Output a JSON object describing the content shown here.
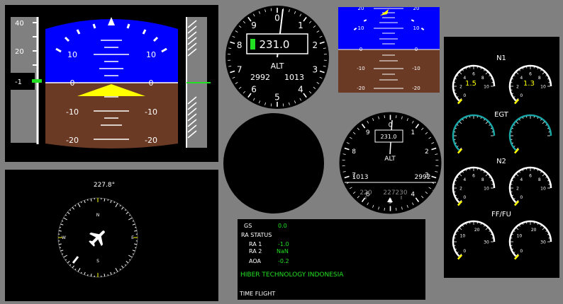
{
  "pfd": {
    "speed_ticks": [
      "40",
      "20",
      "-1"
    ],
    "pitch_labels": [
      "10",
      "0",
      "-10",
      "-20"
    ],
    "colors": {
      "sky": "#0000ff",
      "ground": "#6b3a24",
      "aircraft": "#ffff00",
      "marker": "#22e022"
    }
  },
  "mini_attitude": {
    "pitch_labels": [
      "20",
      "10",
      "0",
      "-10",
      "-20"
    ]
  },
  "altimeter_large": {
    "value": "231.0",
    "label": "ALT",
    "baro_left": "2992",
    "baro_right": "1013",
    "dial": [
      "0",
      "1",
      "2",
      "3",
      "4",
      "5",
      "6",
      "7",
      "8",
      "9"
    ]
  },
  "altimeter_small": {
    "value": "231.0",
    "label": "ALT",
    "baro_left": "1013",
    "baro_right": "2992",
    "dial": [
      "0",
      "1",
      "2",
      "3",
      "4",
      "5",
      "6",
      "7",
      "8",
      "9"
    ],
    "heading_tape": [
      "220",
      "227",
      "230",
      "2"
    ]
  },
  "compass": {
    "heading": "227.8°",
    "cardinals": [
      "N",
      "E",
      "S",
      "W"
    ]
  },
  "data_panel": {
    "rows": [
      {
        "label": "GS",
        "value": "0.0"
      },
      {
        "label": "RA STATUS",
        "value": ""
      },
      {
        "label": "RA 1",
        "value": "-1.0"
      },
      {
        "label": "RA 2",
        "value": "NaN"
      },
      {
        "label": "AOA",
        "value": "-0.2"
      }
    ],
    "company": "HIBER TECHNOLOGY INDONESIA",
    "time_flight": "TIME FLIGHT"
  },
  "engine": {
    "n1_title": "N1",
    "n1_left_value": "1.5",
    "n1_right_value": "1.3",
    "egt_title": "EGT",
    "n2_title": "N2",
    "ff_title": "FF/FU",
    "gauge_scale_n": [
      "0",
      "2",
      "4",
      "6",
      "8",
      "10"
    ],
    "gauge_scale_ff": [
      "0",
      "10",
      "20",
      "30"
    ],
    "colors": {
      "arc": "#1aa6a6",
      "needle": "#ffff00"
    }
  }
}
